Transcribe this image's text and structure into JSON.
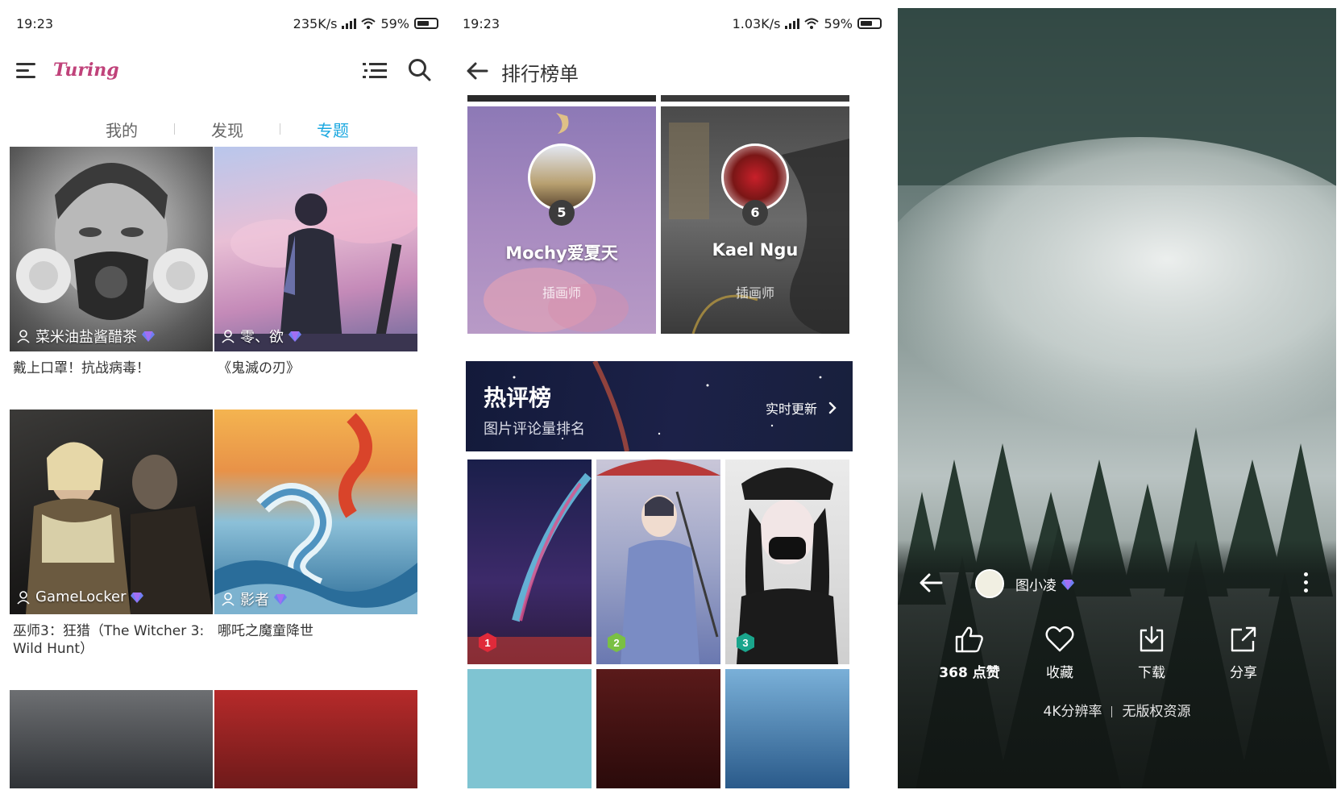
{
  "panel1": {
    "status": {
      "time": "19:23",
      "speed": "235K/s",
      "battery": "59%"
    },
    "logo": "Turing",
    "tabs": [
      {
        "label": "我的",
        "active": false
      },
      {
        "label": "发现",
        "active": false
      },
      {
        "label": "专题",
        "active": true
      }
    ],
    "cards": [
      {
        "author": "菜米油盐酱醋茶",
        "caption": "戴上口罩！抗战病毒！"
      },
      {
        "author": "零、欲",
        "caption": "《鬼滅の刃》"
      },
      {
        "author": "GameLocker",
        "caption": "巫师3：狂猎（The Witcher 3: Wild Hunt）"
      },
      {
        "author": "影者",
        "caption": "哪吒之魔童降世"
      }
    ],
    "accent": "#1ba8e0"
  },
  "panel2": {
    "status": {
      "time": "19:23",
      "speed": "1.03K/s",
      "battery": "59%"
    },
    "title": "排行榜单",
    "ranks": [
      {
        "rank": "5",
        "name": "Mochy爱夏天",
        "role": "插画师"
      },
      {
        "rank": "6",
        "name": "Kael Ngu",
        "role": "插画师"
      }
    ],
    "hot": {
      "title": "热评榜",
      "subtitle": "图片评论量排名",
      "update": "实时更新"
    },
    "thumb_ranks": [
      {
        "rank": "1",
        "color": "#e02a3a"
      },
      {
        "rank": "2",
        "color": "#7ac043"
      },
      {
        "rank": "3",
        "color": "#1aa58c"
      }
    ]
  },
  "panel3": {
    "username": "图小凌",
    "likes": "368 点赞",
    "collect": "收藏",
    "download": "下载",
    "share": "分享",
    "resolution": "4K分辨率",
    "copyright": "无版权资源"
  }
}
